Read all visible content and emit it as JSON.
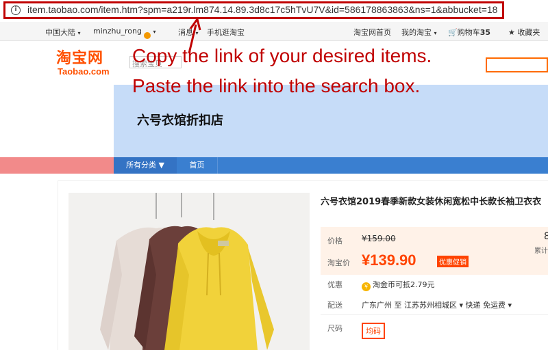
{
  "browser": {
    "url": "item.taobao.com/item.htm?spm=a219r.lm874.14.89.3d8c17c5hTvU7V&id=586178863863&ns=1&abbucket=18"
  },
  "topnav": {
    "region": "中国大陆",
    "username": "minzhu_rong",
    "messages": "消息",
    "mobile": "手机逛淘宝",
    "home": "淘宝网首页",
    "my_taobao": "我的淘宝",
    "cart_label": "购物车",
    "cart_count": "35",
    "favorites": "收藏夹"
  },
  "logo": {
    "cn": "淘宝网",
    "en": "Taobao.com"
  },
  "search": {
    "placeholder": "搜索宝贝"
  },
  "annotation": {
    "line1": "Copy the link of your desired items.",
    "line2": "Paste the link into the search box."
  },
  "shop": {
    "name": "六号衣馆折扣店",
    "nav_all": "所有分类 ▼",
    "nav_home": "首页"
  },
  "product": {
    "title": "六号衣馆2019春季新款女装休闲宽松中长款长袖卫衣衣",
    "price_label": "价格",
    "original_price": "¥159.00",
    "tb_price_label": "淘宝价",
    "tb_price": "¥139.90",
    "promo_badge": "优惠促销",
    "sales_number": "8",
    "sales_label": "累计",
    "discount_label": "优惠",
    "discount_text": "淘金币可抵2.79元",
    "shipping_label": "配送",
    "shipping_text": "广东广州 至  江苏苏州相城区 ▾   快递 免运费 ▾",
    "size_label": "尺码",
    "size_option": "均码"
  },
  "colors": {
    "annotation_red": "#c00000",
    "taobao_orange": "#ff5000",
    "banner_blue": "#c6dcf8",
    "nav_blue": "#3a7fd0"
  }
}
